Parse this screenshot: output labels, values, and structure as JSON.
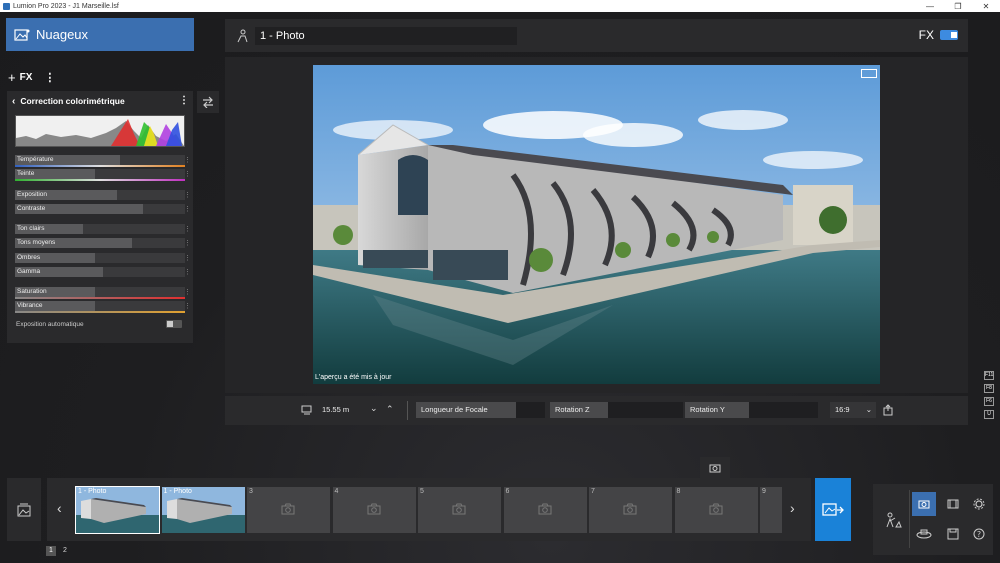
{
  "window": {
    "title": "Lumion Pro 2023 - J1 Marseille.lsf"
  },
  "left_panel": {
    "weather_label": "Nuageux",
    "fx_add_label": "FX",
    "effect_title": "Correction colorimétrique",
    "sliders": [
      {
        "label": "Température",
        "value": 0.62
      },
      {
        "label": "Teinte",
        "value": 0.47
      },
      {
        "label": "Exposition",
        "value": 0.6
      },
      {
        "label": "Contraste",
        "value": 0.75
      },
      {
        "label": "Ton clairs",
        "value": 0.4
      },
      {
        "label": "Tons moyens",
        "value": 0.69
      },
      {
        "label": "Ombres",
        "value": 0.47
      },
      {
        "label": "Gamma",
        "value": 0.52
      },
      {
        "label": "Saturation",
        "value": 0.47
      },
      {
        "label": "Vibrance",
        "value": 0.47
      }
    ],
    "auto_exposure_label": "Exposition automatique"
  },
  "top_bar": {
    "photo_name": "1 - Photo",
    "fx_label": "FX"
  },
  "viewport": {
    "status_text": "L'aperçu a été mis à jour"
  },
  "camera_bar": {
    "height_value": "15.55 m",
    "focal_label": "Longueur de Focale",
    "rotation_z_label": "Rotation Z",
    "rotation_y_label": "Rotation Y",
    "aspect_value": "16:9"
  },
  "function_keys": [
    "F11",
    "F8",
    "F6",
    "U"
  ],
  "filmstrip": {
    "slots": [
      {
        "label": "1 - Photo",
        "filled": true
      },
      {
        "label": "1 - Photo",
        "filled": true
      },
      {
        "label": "3",
        "filled": false
      },
      {
        "label": "4",
        "filled": false
      },
      {
        "label": "5",
        "filled": false
      },
      {
        "label": "6",
        "filled": false
      },
      {
        "label": "7",
        "filled": false
      },
      {
        "label": "8",
        "filled": false
      },
      {
        "label": "9",
        "filled": false
      }
    ]
  },
  "pages": [
    "1",
    "2"
  ],
  "colors": {
    "accent_blue": "#3b6fb0",
    "render_blue": "#1a82d8",
    "panel": "#2a2a2c"
  }
}
